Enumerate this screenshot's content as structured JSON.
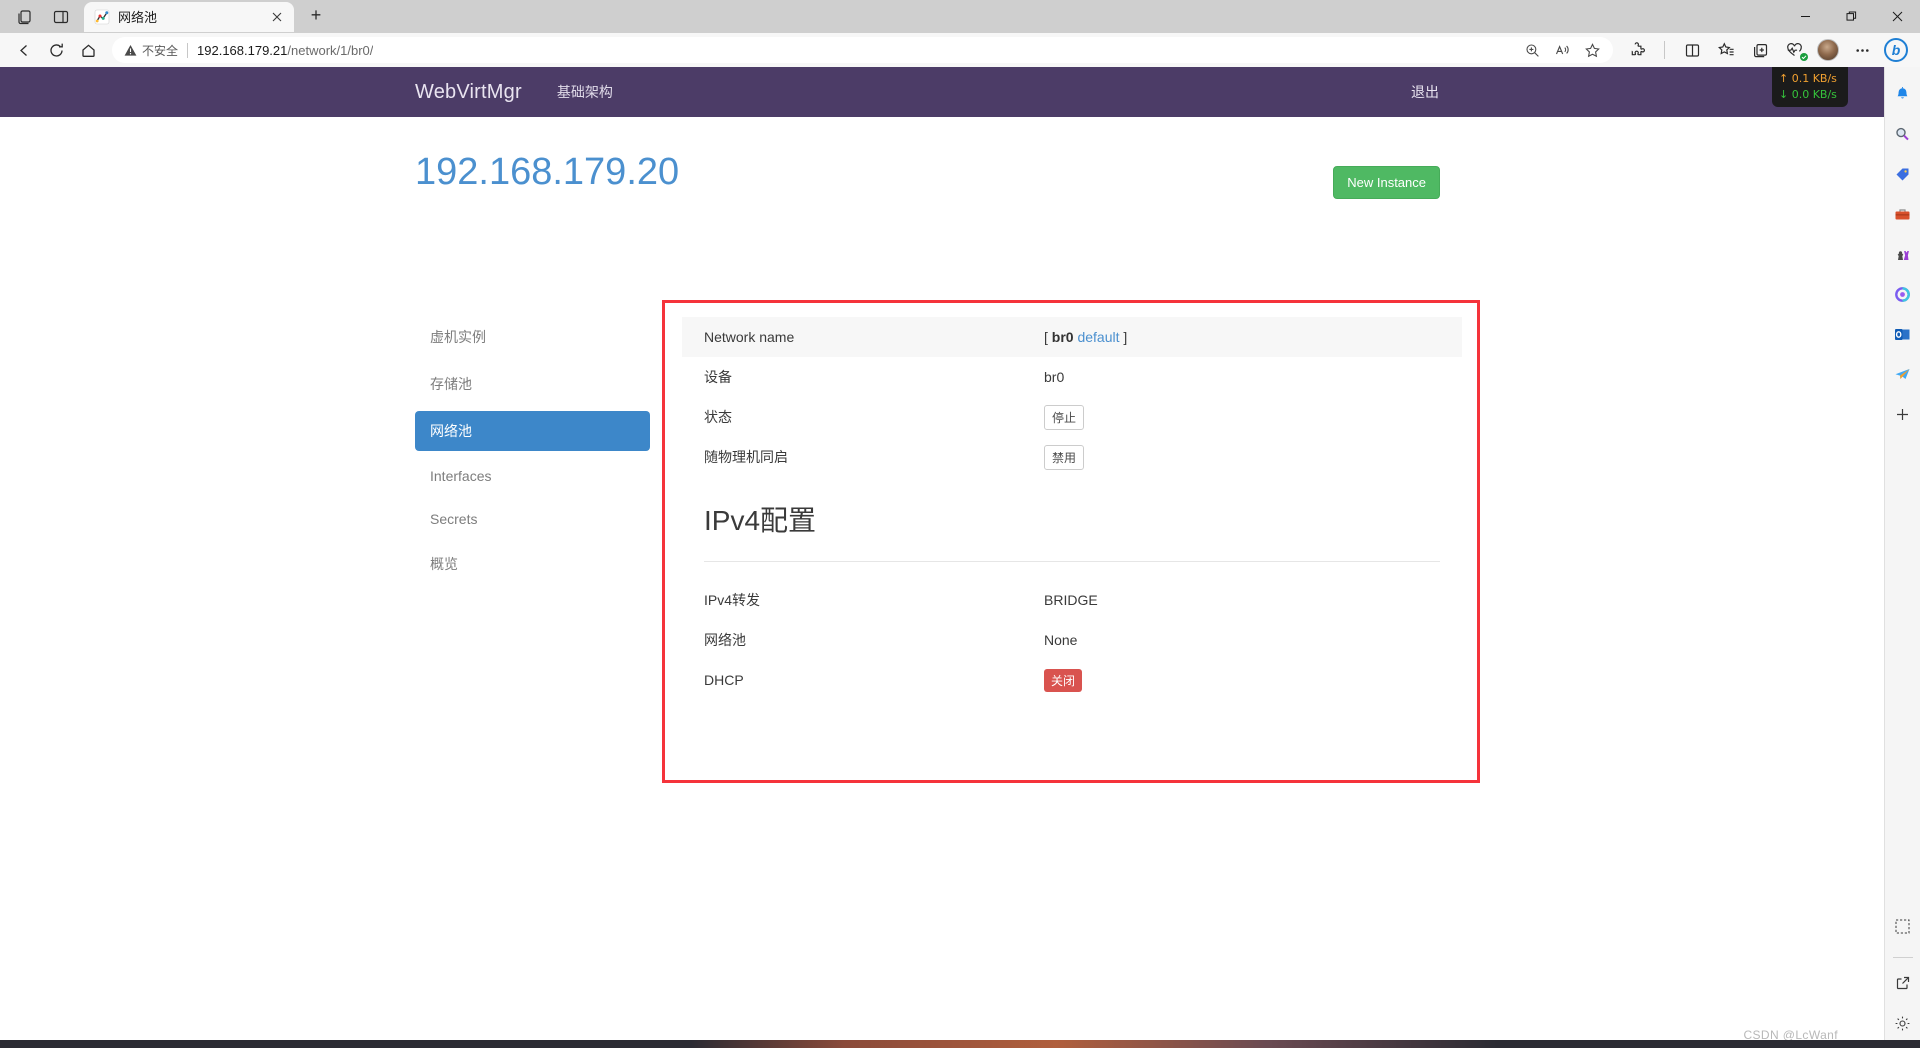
{
  "browser": {
    "tab": {
      "title": "网络池",
      "favicon_icon": "chart-favicon",
      "close_icon": "close-icon"
    },
    "newtab_label": "+",
    "collections_icon": "collections-icon",
    "split_screen_icon": "split-screen-icon",
    "window_controls": {
      "minimize": "minimize-icon",
      "restore": "restore-icon",
      "close": "close-icon"
    },
    "toolbar": {
      "back_icon": "back-arrow-icon",
      "refresh_icon": "refresh-icon",
      "home_icon": "home-icon",
      "warning_label": "不安全",
      "url_host": "192.168.179.21",
      "url_path": "/network/1/br0/",
      "zoom_icon": "zoom-in-icon",
      "read_aloud_icon": "read-aloud-icon",
      "favorite_icon": "star-icon",
      "extensions_icon": "extensions-puzzle-icon",
      "split_icon": "split-screen-icon",
      "favorites_bar_icon": "favorites-list-icon",
      "collections_icon": "collections-add-icon",
      "browser_essentials_icon": "browser-essentials-icon",
      "profile_icon": "avatar",
      "settings_more_icon": "more-ellipsis-icon",
      "copilot_icon": "bing-copilot-icon"
    }
  },
  "edge_sidebar": {
    "items": [
      {
        "icon": "bell-notification-icon",
        "glyph": "🔔"
      },
      {
        "icon": "search-icon",
        "glyph": "🔍"
      },
      {
        "icon": "shopping-tag-icon",
        "glyph": "🏷"
      },
      {
        "icon": "toolbox-icon",
        "glyph": "🧰"
      },
      {
        "icon": "games-chess-icon",
        "glyph": "♟"
      },
      {
        "icon": "microsoft-designer-icon",
        "glyph": "◍"
      },
      {
        "icon": "outlook-icon",
        "glyph": "📧"
      },
      {
        "icon": "telegram-icon",
        "glyph": "✈"
      },
      {
        "icon": "add-sidebar-app-icon",
        "glyph": "＋"
      }
    ],
    "bottom_items": [
      {
        "icon": "screenshot-snip-icon",
        "glyph": "✂"
      },
      {
        "icon": "open-external-icon",
        "glyph": "⧉"
      },
      {
        "icon": "settings-gear-icon",
        "glyph": "⚙"
      }
    ]
  },
  "net_speed": {
    "upload": "0.1 KB/s",
    "download": "0.0 KB/s",
    "upload_arrow": "↑",
    "download_arrow": "↓",
    "upload_color": "#f0a030",
    "download_color": "#35c23b"
  },
  "app": {
    "brand": "WebVirtMgr",
    "nav_link": "基础架构",
    "logout": "退出",
    "navbar_color": "#4c3c67",
    "page_title": "192.168.179.20",
    "page_title_color": "#4b90cf",
    "new_instance_button": "New Instance",
    "new_instance_color": "#4fb963"
  },
  "sidebar": {
    "items": [
      {
        "label": "虚机实例",
        "active": false
      },
      {
        "label": "存储池",
        "active": false
      },
      {
        "label": "网络池",
        "active": true
      },
      {
        "label": "Interfaces",
        "active": false
      },
      {
        "label": "Secrets",
        "active": false
      },
      {
        "label": "概览",
        "active": false
      }
    ],
    "active_color": "#3d87c9"
  },
  "network_detail": {
    "rows": [
      {
        "label": "Network name",
        "value_prefix": "[ ",
        "value_bold": "br0",
        "value_link": "default",
        "value_suffix": " ]",
        "shaded": true
      },
      {
        "label": "设备",
        "value": "br0",
        "shaded": false
      },
      {
        "label": "状态",
        "badge": "停止",
        "badge_type": "outline",
        "shaded": false
      },
      {
        "label": "随物理机同启",
        "badge": "禁用",
        "badge_type": "outline",
        "shaded": false
      }
    ],
    "ipv4_section_title": "IPv4配置",
    "ipv4_rows": [
      {
        "label": "IPv4转发",
        "value": "BRIDGE",
        "shaded": false
      },
      {
        "label": "网络池",
        "value": "None",
        "shaded": false
      },
      {
        "label": "DHCP",
        "badge": "关闭",
        "badge_type": "danger",
        "shaded": false
      }
    ]
  },
  "annotation": {
    "box_color": "#f5333b"
  },
  "watermark": "CSDN @LcWanf"
}
